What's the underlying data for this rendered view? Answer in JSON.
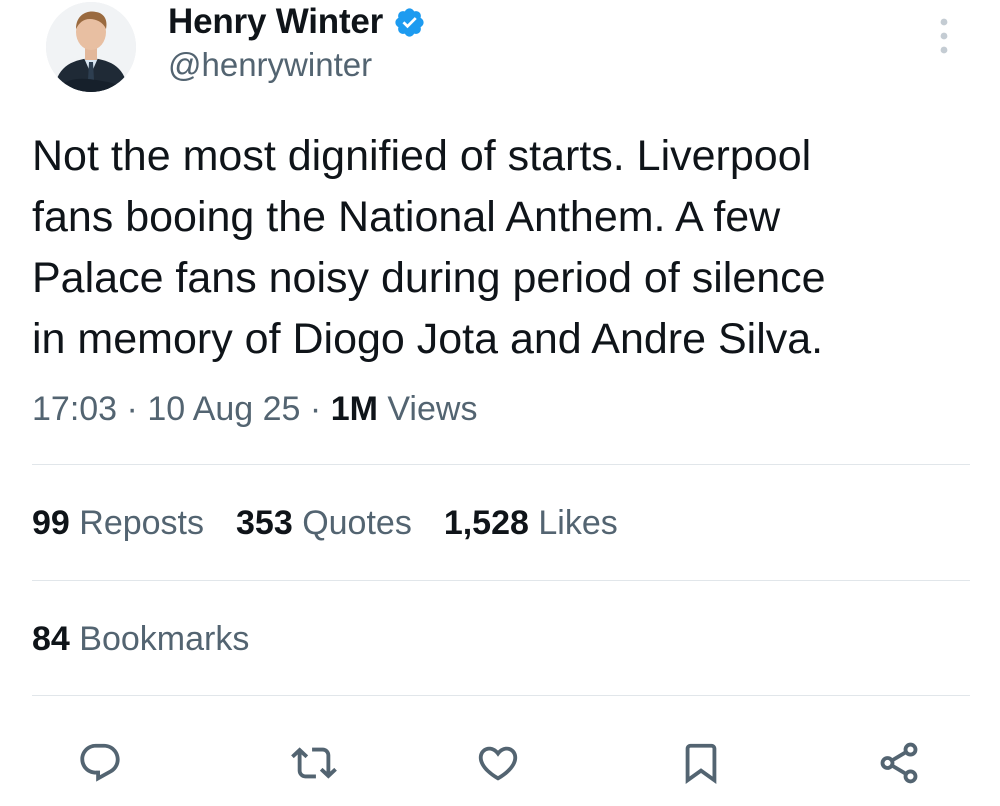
{
  "author": {
    "name": "Henry Winter",
    "handle": "@henrywinter",
    "verified": true
  },
  "tweet": {
    "text": "Not the most dignified of starts. Liverpool\nfans booing the National Anthem. A few\nPalace fans noisy during period of silence\nin memory of Diogo Jota and Andre Silva."
  },
  "meta": {
    "time": "17:03",
    "separator": " · ",
    "date": "10 Aug 25",
    "views_count": "1M",
    "views_label": " Views"
  },
  "stats": {
    "reposts": {
      "count": "99",
      "label": " Reposts"
    },
    "quotes": {
      "count": "353",
      "label": " Quotes"
    },
    "likes": {
      "count": "1,528",
      "label": " Likes"
    },
    "bookmarks": {
      "count": "84",
      "label": " Bookmarks"
    }
  },
  "icons": {
    "reply": "speech-bubble-icon",
    "repost": "repost-arrows-icon",
    "like": "heart-icon",
    "bookmark": "bookmark-icon",
    "share": "share-nodes-icon",
    "more": "vertical-ellipsis-icon",
    "verified": "verified-badge-icon"
  },
  "colors": {
    "primary_text": "#0f1419",
    "secondary_text": "#536471",
    "verified_blue": "#1d9bf0",
    "divider": "#e1e6ea"
  }
}
